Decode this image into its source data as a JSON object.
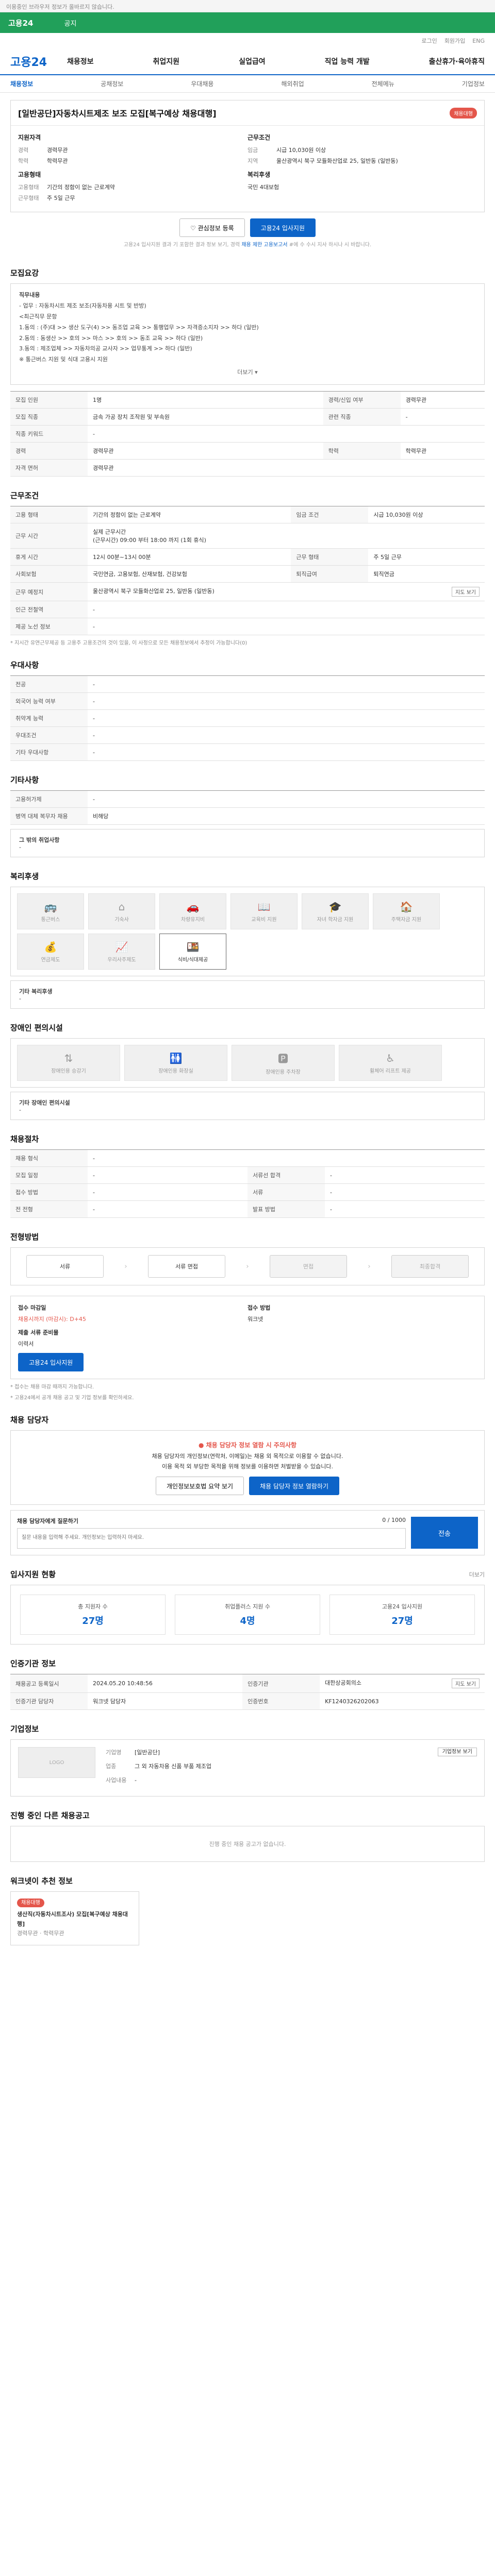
{
  "topbar": "이용중인 브라우저 정보가 올바르지 않습니다.",
  "greenbar": {
    "title": "고용24",
    "sub": "공지"
  },
  "util": [
    "로그인",
    "회원가입",
    "ENG"
  ],
  "gnb": {
    "logo": "고용24",
    "menu": [
      "채용정보",
      "취업지원",
      "실업급여",
      "직업 능력 개발",
      "출산휴가·육아휴직"
    ]
  },
  "lnb": [
    "채용정보",
    "공채정보",
    "우대채용",
    "해외취업",
    "전체메뉴",
    "기업정보"
  ],
  "job": {
    "title": "[일반공단]자동차시트제조 보조 모집[복구예상 채용대행]",
    "badge": "채용대행",
    "company_h": "지원자격",
    "kv1": [
      {
        "k": "경력",
        "v": "경력무관"
      },
      {
        "k": "학력",
        "v": "학력무관"
      }
    ],
    "work_h": "근무조건",
    "kv2": [
      {
        "k": "임금",
        "v": "시급 10,030원 이상"
      },
      {
        "k": "지역",
        "v": "울산광역시 북구 모듈화산업로 25, 일반동 (일반동)"
      }
    ],
    "emp_h": "고용형태",
    "kv3": [
      {
        "k": "고용형태",
        "v": "기간의 정함이 없는 근로계약"
      },
      {
        "k": "근무형태",
        "v": "주 5일 근무"
      }
    ],
    "welfare_h": "복리후생",
    "kv4": [
      {
        "k": "",
        "v": "국민 4대보험"
      }
    ],
    "btn_scrap": "관심정보 등록",
    "btn_apply": "고용24 입사지원",
    "note_a": "고용24 입사지원 결과 기 포함한 결과 정보 보기, 경력",
    "note_hl": "채용 제한 고용보고서",
    "note_b": "#에 수 수시 지사 하시나 시 바랍니다."
  },
  "recruit": {
    "title": "모집요강",
    "desc": [
      "직무내용",
      "- 업무 : 자동차시트 제조 보조(자동차용 시트 및 반방)",
      "<최근직무 문항",
      "1.동의 : (주)대 >> 생산 도구(4) >> 동조업 교육 >> 통행업무 >> 자격증소지자 >> 하다 (일반)",
      "2.동의 : 동생산 >> 호의 >> 마스 >> 호의 >> 동조 교육 >> 하다 (일반)",
      "3.동의 : 제조업체 >> 자동차의공 교사자 >> 업무통계 >> 하다 (일반)",
      "※ 통근버스 지원 및 식대 고용시 지원"
    ],
    "more": "더보기",
    "rows": [
      {
        "k": "모집 인원",
        "v": "1명",
        "k2": "경력/신입 여부",
        "v2": "경력무관"
      },
      {
        "k": "모집 직종",
        "v": "금속 가공 장치 조작원 및 부속원",
        "k2": "관련 직종",
        "v2": "-"
      },
      {
        "k": "직종 키워드",
        "v": "-"
      },
      {
        "k": "경력",
        "v": "경력무관",
        "k2": "학력",
        "v2": "학력무관"
      },
      {
        "k": "자격 면허",
        "v": "경력무관"
      }
    ]
  },
  "work": {
    "title": "근무조건",
    "rows": [
      {
        "k": "고용 형태",
        "v": "기간의 정함이 없는 근로계약",
        "k2": "임금 조건",
        "v2": "시급 10,030원 이상"
      },
      {
        "k": "근무 시간",
        "v": "실제 근무시간\n(근무시간) 09:00 부터 18:00 까지 (1회 휴식)",
        "k2": "",
        "v2": ""
      },
      {
        "k": "휴게 시간",
        "v": "12시 00분~13시 00분",
        "k2": "근무 형태",
        "v2": "주 5일 근무"
      },
      {
        "k": "사회보험",
        "v": "국민연금, 고용보험, 산재보험, 건강보험",
        "k2": "퇴직급여",
        "v2": "퇴직연금"
      },
      {
        "k": "근무 예정지",
        "v": "울산광역시 북구 모듈화산업로 25, 일반동 (일반동)",
        "k2": "",
        "v2": ""
      },
      {
        "k": "인근 전철역",
        "v": "-"
      },
      {
        "k": "제공 노선 정보",
        "v": "-"
      }
    ],
    "map_btn": "지도 보기",
    "fn": "* 지시간 유연근무제공 등 고용주 고용조건의 것이 있을, 이 사정으로 모든 채용정보에서 추정이 가능합니다(0)"
  },
  "pref": {
    "title": "우대사항",
    "rows": [
      {
        "k": "전공",
        "v": "-"
      },
      {
        "k": "외국어 능력 여부",
        "v": "-"
      },
      {
        "k": "취약계 능력",
        "v": "-"
      },
      {
        "k": "우대조건",
        "v": "-"
      },
      {
        "k": "기타 우대사항",
        "v": "-"
      }
    ]
  },
  "etc": {
    "title": "기타사항",
    "rows": [
      {
        "k": "고용허가제",
        "v": "-"
      },
      {
        "k": "병역 대체 복무자 채용",
        "v": "비해당"
      }
    ],
    "sub_h": "그 밖의 취업사항",
    "sub_v": "-"
  },
  "welfare": {
    "title": "복리후생",
    "items": [
      "통근버스",
      "기숙사",
      "차량유지비",
      "교육비 지원",
      "자녀 학자금 지원",
      "주택자금 지원",
      "연금제도",
      "우리사주제도",
      "식비/식대제공"
    ],
    "box_h": "기타 복리후생",
    "box_v": "-"
  },
  "disability": {
    "title": "장애인 편의시설",
    "items": [
      "장애인용 승강기",
      "장애인용 화장실",
      "장애인용 주차장",
      "휠체어 리프트 제공"
    ],
    "box_h": "기타 장애인 편의시설",
    "box_v": "-"
  },
  "process": {
    "title": "채용절차",
    "rows": [
      {
        "k": "채용 형식",
        "v": "-"
      },
      {
        "k": "모집 일정",
        "v": "-",
        "k2": "서류선 합격",
        "v2": "-"
      },
      {
        "k": "접수 방법",
        "v": "-",
        "k2": "서류",
        "v2": "-"
      },
      {
        "k": "전 전형",
        "v": "-",
        "k2": "발표 방법",
        "v2": "-"
      }
    ]
  },
  "progress": {
    "title": "전형방법",
    "steps": [
      "서류",
      "서류 면접",
      "면접",
      "최종합격"
    ]
  },
  "apply": {
    "deadline_h": "접수 마감일",
    "deadline_v": "채용시까지 (마감시): D+45",
    "method_h": "접수 방법",
    "method_v": "워크넷",
    "docs_h": "제출 서류 준비물",
    "docs_v": "이력서",
    "btn": "고용24 입사지원",
    "fn1": "* 접수는 채용 마감 때까지 가능합니다.",
    "fn2": "* 고용24에서 공개 채용 공고 및 기업 정보를 확인하세요."
  },
  "manager": {
    "title": "채용 담당자",
    "warn": "채용 담당자 정보 열람 시 주의사항",
    "l1": "채용 담당자의 개인정보(연락처, 이메일)는 채용 외 목적으로 이용할 수 없습니다.",
    "l2": "이용 목적 외 부당한 목적을 위해 정보를 이용하면 처벌받을 수 있습니다.",
    "btn1": "개인정보보호법 요약 보기",
    "btn2": "채용 담당자 정보 열람하기",
    "inq_h": "채용 담당자에게 질문하기",
    "inq_count": "0 / 1000",
    "inq_ph": "질문 내용을 입력해 주세요. 개인정보는 입력하지 마세요.",
    "inq_btn": "전송"
  },
  "stats": {
    "title": "입사지원 현황",
    "more": "더보기",
    "items": [
      {
        "l": "총 지원자 수",
        "n": "27명"
      },
      {
        "l": "취업플러스 지원 수",
        "n": "4명"
      },
      {
        "l": "고용24 입사지원",
        "n": "27명"
      }
    ]
  },
  "info": {
    "title": "인증기관 정보",
    "rows": [
      {
        "k": "채용공고 등록일시",
        "v": "2024.05.20 10:48:56",
        "k2": "인증기관",
        "v2": "대한상공회의소"
      },
      {
        "k": "인증기관 담당자",
        "v": "워크넷 담당자",
        "k2": "인증번호",
        "v2": "KF1240326202063"
      }
    ],
    "map_btn": "지도 보기"
  },
  "corp": {
    "title": "기업정보",
    "logo_ph": "LOGO",
    "rows": [
      {
        "k": "기업명",
        "v": "[일반공단]"
      },
      {
        "k": "업종",
        "v": "그 외 자동차용 신품 부품 제조업"
      },
      {
        "k": "사업내용",
        "v": "-"
      }
    ],
    "more": "기업정보 보기"
  },
  "other": {
    "title": "진행 중인 다른 채용공고",
    "empty": "진행 중인 채용 공고가 없습니다."
  },
  "rec": {
    "title": "워크넷이 추천 정보",
    "badge": "채용대행",
    "line1": "생산직(자동차시트조사) 모집[복구예상 채용대행]",
    "line2": "경력무관 · 학력무관"
  }
}
